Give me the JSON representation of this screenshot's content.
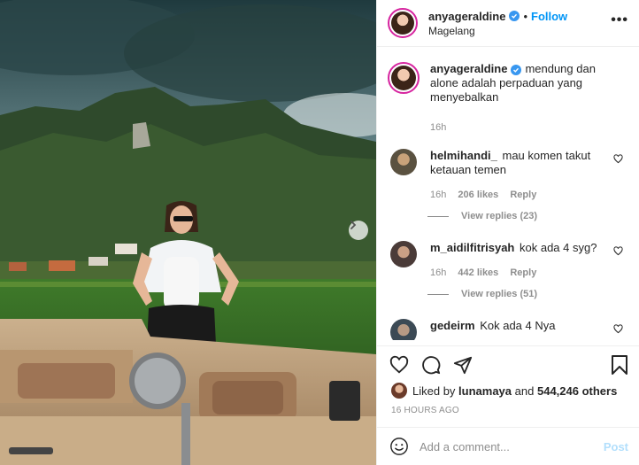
{
  "post": {
    "username": "anyageraldine",
    "follow_label": "Follow",
    "separator": "•",
    "location": "Magelang",
    "more_label": "•••",
    "caption_text": "mendung dan alone adalah perpaduan yang menyebalkan",
    "caption_time": "16h"
  },
  "comments": [
    {
      "username": "helmihandi_",
      "text": "mau komen takut ketauan temen",
      "time": "16h",
      "likes": "206 likes",
      "reply": "Reply",
      "view_replies": "View replies (23)",
      "avatar_color": "#5a5140"
    },
    {
      "username": "m_aidilfitrisyah",
      "text": "kok ada 4 syg?",
      "time": "16h",
      "likes": "442 likes",
      "reply": "Reply",
      "view_replies": "View replies (51)",
      "avatar_color": "#4a3b38"
    },
    {
      "username": "gedeirm",
      "text": "Kok ada 4 Nya",
      "avatar_color": "#3c4a55"
    }
  ],
  "engagement": {
    "liked_by_prefix": "Liked by",
    "liked_by_user": "lunamaya",
    "and_label": "and",
    "others_label": "544,246 others",
    "timestamp": "16 HOURS AGO"
  },
  "composer": {
    "placeholder": "Add a comment...",
    "post_label": "Post"
  },
  "icons": {
    "like": "heart-icon",
    "comment": "comment-icon",
    "share": "send-icon",
    "save": "bookmark-icon",
    "emoji": "emoji-icon",
    "next": "chevron-right-icon",
    "verified": "verified-badge-icon"
  },
  "colors": {
    "accent": "#0095f6",
    "verified": "#3897f0",
    "muted": "#8e8e8e",
    "post_disabled": "#b2dffc"
  }
}
